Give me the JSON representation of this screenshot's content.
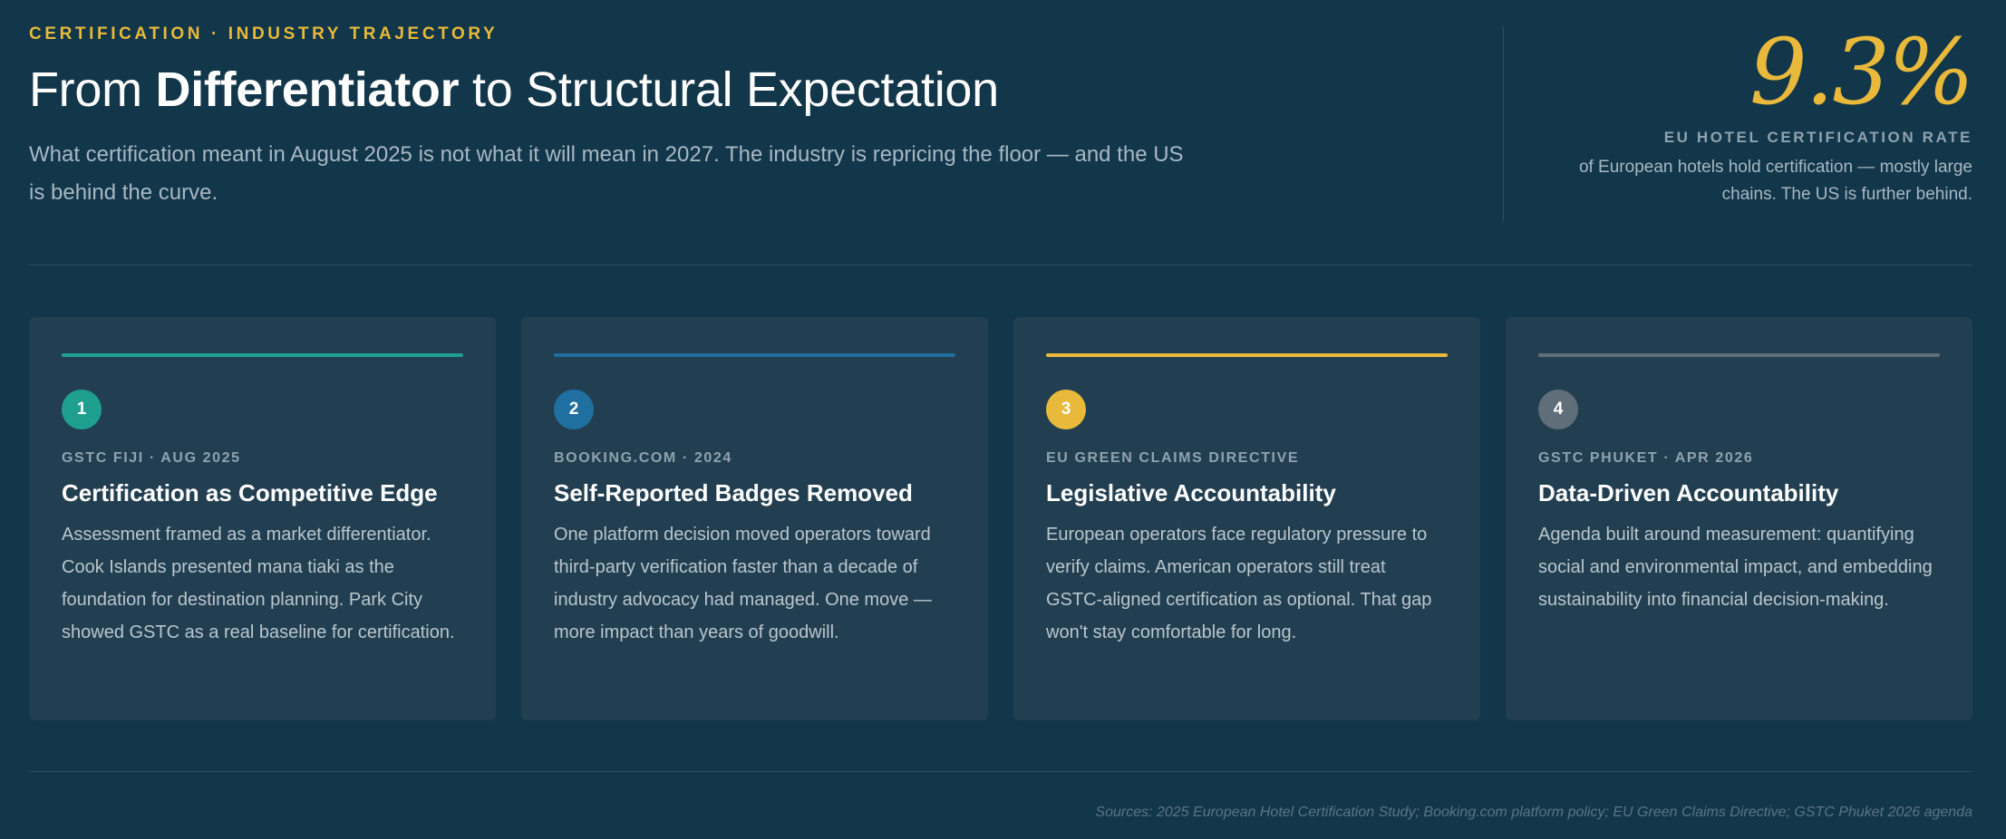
{
  "header": {
    "eyebrow": "CERTIFICATION · INDUSTRY TRAJECTORY",
    "title_pre": "From ",
    "title_bold": "Differentiator",
    "title_post": " to Structural Expectation",
    "subtitle": "What certification meant in August 2025 is not what it will mean in 2027. The industry is repricing the floor — and the US is behind the curve."
  },
  "stat": {
    "value": "9.3%",
    "label": "EU HOTEL CERTIFICATION RATE",
    "description": "of European hotels hold certification — mostly large chains. The US is further behind."
  },
  "colors": {
    "accent_gold": "#e8b93a",
    "teal": "#1fa08e",
    "blue": "#1f6fa0",
    "gold": "#e8b93a",
    "slate": "#5f6e79"
  },
  "cards": [
    {
      "number": "1",
      "tag": "GSTC FIJI · AUG 2025",
      "title": "Certification as Competitive Edge",
      "body": "Assessment framed as a market differentiator. Cook Islands presented mana tiaki as the foundation for destination planning. Park City showed GSTC as a real baseline for certification.",
      "color": "#1fa08e"
    },
    {
      "number": "2",
      "tag": "BOOKING.COM · 2024",
      "title": "Self-Reported Badges Removed",
      "body": "One platform decision moved operators toward third-party verification faster than a decade of industry advocacy had managed. One move — more impact than years of goodwill.",
      "color": "#1f6fa0"
    },
    {
      "number": "3",
      "tag": "EU GREEN CLAIMS DIRECTIVE",
      "title": "Legislative Accountability",
      "body": "European operators face regulatory pressure to verify claims. American operators still treat GSTC-aligned certification as optional. That gap won't stay comfortable for long.",
      "color": "#e8b93a"
    },
    {
      "number": "4",
      "tag": "GSTC PHUKET · APR 2026",
      "title": "Data-Driven Accountability",
      "body": "Agenda built around measurement: quantifying social and environmental impact, and embedding sustainability into financial decision-making.",
      "color": "#5f6e79"
    }
  ],
  "footer": {
    "sources": "Sources: 2025 European Hotel Certification Study; Booking.com platform policy; EU Green Claims Directive; GSTC Phuket 2026 agenda"
  }
}
